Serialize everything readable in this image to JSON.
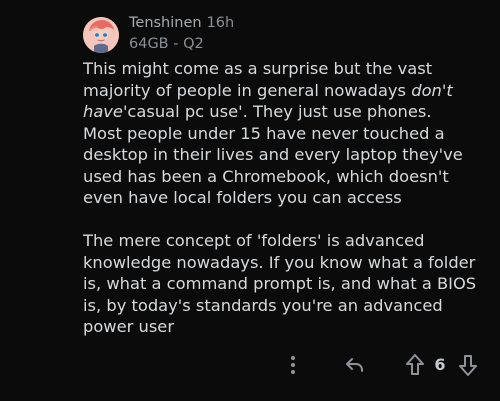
{
  "comment": {
    "author": "Tenshinen",
    "time": "16h",
    "flair": "64GB - Q2",
    "paragraph1": {
      "line1": "This might come as a surprise but the vast",
      "line2": "majority of people in general nowadays",
      "line2_emphasis": "don't",
      "line3_emphasis": "have",
      "line3": "'casual pc use'. They just use phones.",
      "line4": "Most people under 15 have never touched a",
      "line5": "desktop in their lives and every laptop they've",
      "line6": "used has been a Chromebook, which doesn't",
      "line7": "even have local folders you can access"
    },
    "paragraph2": {
      "line1": "The mere concept of 'folders' is advanced",
      "line2": "knowledge nowadays. If you know what a folder",
      "line3": "is, what a command prompt is, and what a BIOS",
      "line4": "is, by today's standards you're an advanced",
      "line5": "power user"
    },
    "score": "6"
  },
  "icons": {
    "avatar": "avatar",
    "more": "more-vertical-icon",
    "reply": "reply-icon",
    "upvote": "upvote-icon",
    "downvote": "downvote-icon"
  },
  "colors": {
    "background": "#0b0b0c",
    "text": "#d7dadc",
    "muted": "#8c9094"
  }
}
